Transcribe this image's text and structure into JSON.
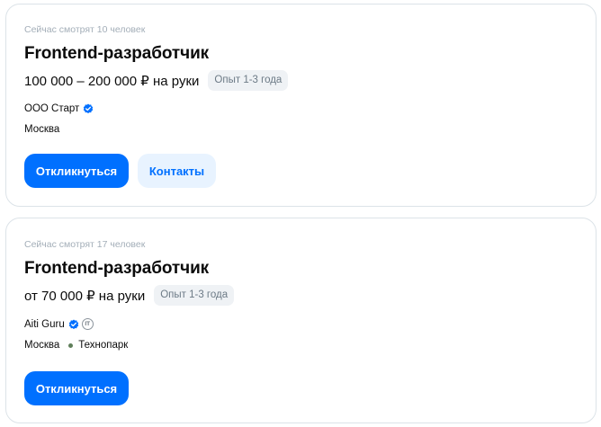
{
  "vacancies": [
    {
      "viewers": "Сейчас смотрят 10 человек",
      "title": "Frontend-разработчик",
      "salary": "100 000 – 200 000 ₽ на руки",
      "experience": "Опыт 1-3 года",
      "company": "ООО Старт",
      "company_verified_icon": "verified-check-icon",
      "location": "Москва",
      "respond_label": "Откликнуться",
      "contacts_label": "Контакты"
    },
    {
      "viewers": "Сейчас смотрят 17 человек",
      "title": "Frontend-разработчик",
      "salary": "от 70 000 ₽ на руки",
      "experience": "Опыт 1-3 года",
      "company": "Aiti Guru",
      "company_verified_icon": "verified-check-icon",
      "company_badge_icon": "it-accreditation-icon",
      "company_badge_text": "IT",
      "location": "Москва",
      "metro": "Технопарк",
      "respond_label": "Откликнуться"
    }
  ],
  "colors": {
    "primary": "#0070ff",
    "secondary_bg": "#e8f3ff",
    "badge_bg": "#eff2f5",
    "muted_text": "#a3aeb8",
    "card_border": "#dce3e8",
    "metro_line": "#5f7f5a"
  }
}
